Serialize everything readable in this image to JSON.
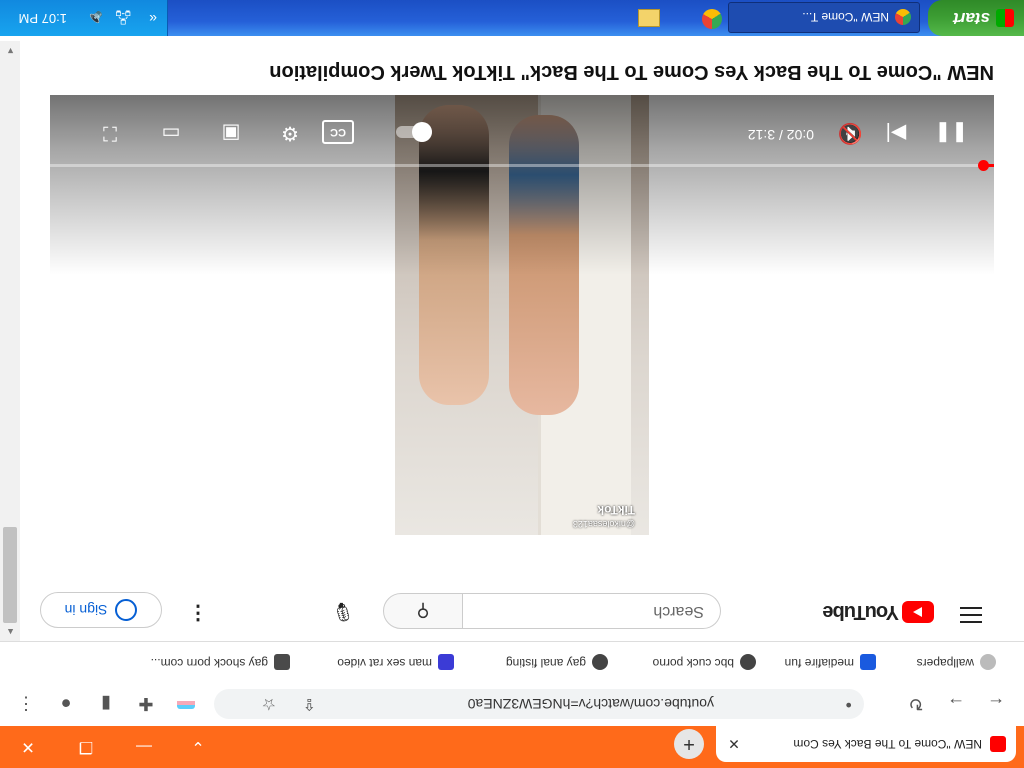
{
  "browser": {
    "tab_title": "NEW \"Come To The Back Yes Com",
    "new_tab_label": "+",
    "url": "youtube.com/watch?v=hNGEW3ZNEa0"
  },
  "bookmarks": [
    {
      "label": "wallpapers",
      "color": "#bbbbbb"
    },
    {
      "label": "mediafire fun",
      "color": "#1a5adf"
    },
    {
      "label": "bbc cuck porno",
      "color": "#444444"
    },
    {
      "label": "gay anal fisting",
      "color": "#444444"
    },
    {
      "label": "man sex rat video",
      "color": "#3b3bd6"
    },
    {
      "label": "gay shock porn com...",
      "color": "#4a4a4a"
    }
  ],
  "youtube": {
    "logo_text": "YouTube",
    "search_placeholder": "Search",
    "sign_in": "Sign in",
    "video_title": "NEW \"Come To The Back Yes Come To The Back\" TikTok Twerk Compilation",
    "player": {
      "current_time": "0:02",
      "duration": "3:12",
      "time_text": "0:02 / 3:12",
      "progress": 0.0104,
      "cc_label": "CC",
      "muted": true
    },
    "tiktok_watermark": "TikTok",
    "tiktok_user": "@nikolesaa123"
  },
  "taskbar": {
    "start_label": "start",
    "window_label": "NEW \"Come T...",
    "clock": "1:07 PM"
  },
  "colors": {
    "tab_bar": "#ff6a1a",
    "youtube_red": "#ff0000",
    "taskbar_blue": "#2560d8",
    "start_green": "#3d9e34"
  }
}
